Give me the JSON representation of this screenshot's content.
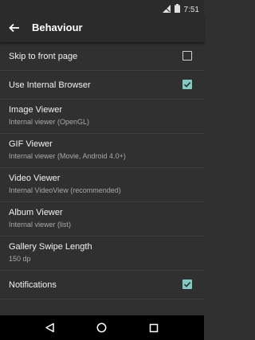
{
  "status_bar": {
    "time": "7:51"
  },
  "app_bar": {
    "title": "Behaviour"
  },
  "settings": [
    {
      "id": "skip-to-front-page",
      "title": "Skip to front page",
      "type": "checkbox",
      "checked": false
    },
    {
      "id": "use-internal-browser",
      "title": "Use Internal Browser",
      "type": "checkbox",
      "checked": true
    },
    {
      "id": "image-viewer",
      "title": "Image Viewer",
      "summary": "Internal viewer (OpenGL)",
      "type": "option"
    },
    {
      "id": "gif-viewer",
      "title": "GIF Viewer",
      "summary": "Internal viewer (Movie, Android 4.0+)",
      "type": "option"
    },
    {
      "id": "video-viewer",
      "title": "Video Viewer",
      "summary": "Internal VideoView (recommended)",
      "type": "option"
    },
    {
      "id": "album-viewer",
      "title": "Album Viewer",
      "summary": "Internal viewer (list)",
      "type": "option"
    },
    {
      "id": "gallery-swipe-length",
      "title": "Gallery Swipe Length",
      "summary": "150 dp",
      "type": "option"
    },
    {
      "id": "notifications",
      "title": "Notifications",
      "type": "checkbox",
      "checked": true
    }
  ],
  "colors": {
    "accent": "#80cbc4",
    "background": "#303030",
    "bar": "#2b2b2b"
  }
}
